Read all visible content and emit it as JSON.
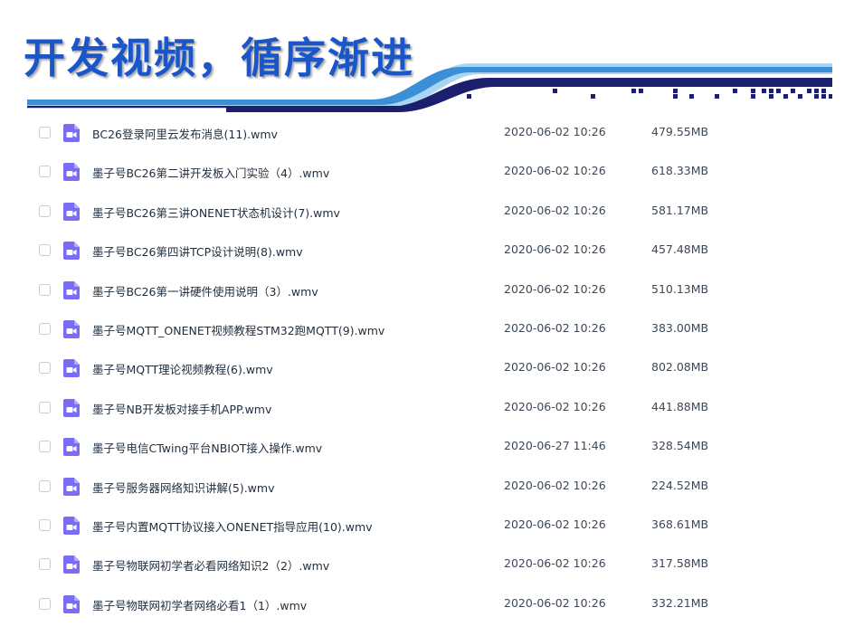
{
  "slide": {
    "title": "开发视频，循序渐进"
  },
  "colors": {
    "title": "#1a56c9",
    "accent_navy": "#1b1f6e",
    "accent_blue": "#3b8fd6",
    "accent_light": "#a9d4f2",
    "file_icon": "#7b6cf6"
  },
  "files": [
    {
      "name": "BC26登录阿里云发布消息(11).wmv",
      "date": "2020-06-02 10:26",
      "size": "479.55MB",
      "icon": "video-file-icon"
    },
    {
      "name": "墨子号BC26第二讲开发板入门实验（4）.wmv",
      "date": "2020-06-02 10:26",
      "size": "618.33MB",
      "icon": "video-file-icon"
    },
    {
      "name": "墨子号BC26第三讲ONENET状态机设计(7).wmv",
      "date": "2020-06-02 10:26",
      "size": "581.17MB",
      "icon": "video-file-icon"
    },
    {
      "name": "墨子号BC26第四讲TCP设计说明(8).wmv",
      "date": "2020-06-02 10:26",
      "size": "457.48MB",
      "icon": "video-file-icon"
    },
    {
      "name": "墨子号BC26第一讲硬件使用说明（3）.wmv",
      "date": "2020-06-02 10:26",
      "size": "510.13MB",
      "icon": "video-file-icon"
    },
    {
      "name": "墨子号MQTT_ONENET视频教程STM32跑MQTT(9).wmv",
      "date": "2020-06-02 10:26",
      "size": "383.00MB",
      "icon": "video-file-icon"
    },
    {
      "name": "墨子号MQTT理论视频教程(6).wmv",
      "date": "2020-06-02 10:26",
      "size": "802.08MB",
      "icon": "video-file-icon"
    },
    {
      "name": "墨子号NB开发板对接手机APP.wmv",
      "date": "2020-06-02 10:26",
      "size": "441.88MB",
      "icon": "video-file-icon"
    },
    {
      "name": "墨子号电信CTwing平台NBIOT接入操作.wmv",
      "date": "2020-06-27 11:46",
      "size": "328.54MB",
      "icon": "video-file-icon"
    },
    {
      "name": "墨子号服务器网络知识讲解(5).wmv",
      "date": "2020-06-02 10:26",
      "size": "224.52MB",
      "icon": "video-file-icon"
    },
    {
      "name": "墨子号内置MQTT协议接入ONENET指导应用(10).wmv",
      "date": "2020-06-02 10:26",
      "size": "368.61MB",
      "icon": "video-file-icon"
    },
    {
      "name": "墨子号物联网初学者必看网络知识2（2）.wmv",
      "date": "2020-06-02 10:26",
      "size": "317.58MB",
      "icon": "video-file-icon"
    },
    {
      "name": "墨子号物联网初学者网络必看1（1）.wmv",
      "date": "2020-06-02 10:26",
      "size": "332.21MB",
      "icon": "video-file-icon"
    }
  ]
}
